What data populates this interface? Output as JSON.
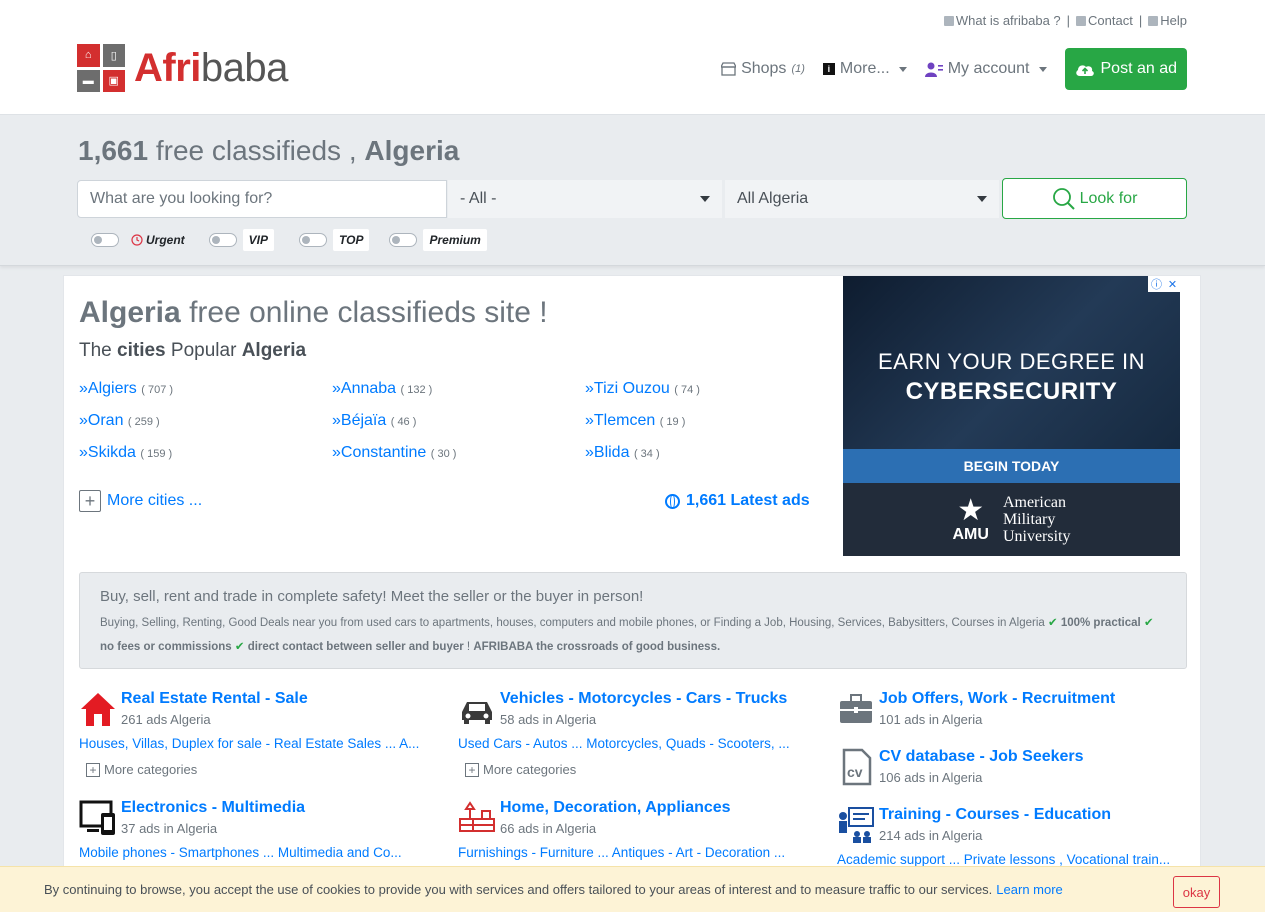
{
  "toplinks": {
    "about": "What is afribaba ?",
    "contact": "Contact",
    "help": "Help"
  },
  "logo": {
    "afri": "Afri",
    "baba": "baba"
  },
  "nav": {
    "shops": "Shops",
    "shops_count": "(1)",
    "more": "More...",
    "account": "My account",
    "post_ad": "Post an ad"
  },
  "search": {
    "count": "1,661",
    "title_rest": "free classifieds ,",
    "country": "Algeria",
    "placeholder": "What are you looking for?",
    "category_value": "- All -",
    "region_value": "All Algeria",
    "button": "Look for",
    "toggles": [
      "Urgent",
      "VIP",
      "TOP",
      "Premium"
    ]
  },
  "main": {
    "h1_bold": "Algeria",
    "h1_rest": "free online classifieds site !",
    "h2_a": "The",
    "h2_b": "cities",
    "h2_c": "Popular",
    "h2_d": "Algeria",
    "cities": [
      {
        "name": "»Algiers",
        "count": "( 707 )"
      },
      {
        "name": "»Annaba",
        "count": "( 132 )"
      },
      {
        "name": "»Tizi Ouzou",
        "count": "( 74 )"
      },
      {
        "name": "»Oran",
        "count": "( 259 )"
      },
      {
        "name": "»Béjaïa",
        "count": "( 46 )"
      },
      {
        "name": "»Tlemcen",
        "count": "( 19 )"
      },
      {
        "name": "»Skikda",
        "count": "( 159 )"
      },
      {
        "name": "»Constantine",
        "count": "( 30 )"
      },
      {
        "name": "»Blida",
        "count": "( 34 )"
      }
    ],
    "more_cities": "More cities ...",
    "latest_ads": "1,661 Latest ads"
  },
  "ad": {
    "line1": "EARN YOUR DEGREE IN",
    "line2": "CYBERSECURITY",
    "cta": "BEGIN TODAY",
    "brand_short": "AMU",
    "brand_l1": "American",
    "brand_l2": "Military",
    "brand_l3": "University"
  },
  "info": {
    "lead": "Buy, sell, rent and trade in complete safety! Meet the seller or the buyer in person!",
    "small": "Buying, Selling, Renting, Good Deals near you from used cars to apartments, houses, computers and mobile phones, or Finding a Job, Housing, Services, Babysitters, Courses in Algeria",
    "b1": "100% practical",
    "b2": "no fees or commissions",
    "b3": "direct contact between seller and buyer",
    "b4": "AFRIBABA the crossroads of good business."
  },
  "categories": [
    {
      "title": "Real Estate Rental - Sale",
      "count": "261 ads Algeria",
      "sub": "Houses, Villas, Duplex for sale - Real Estate Sales ... A...",
      "more": "More categories",
      "icon": "house-icon"
    },
    {
      "title": "Vehicles - Motorcycles - Cars - Trucks",
      "count": "58 ads in Algeria",
      "sub": "Used Cars - Autos ... Motorcycles, Quads - Scooters, ...",
      "more": "More categories",
      "icon": "car-icon"
    },
    {
      "title": "Job Offers, Work - Recruitment",
      "count": "101 ads in Algeria",
      "sub": "",
      "more": "",
      "icon": "briefcase-icon"
    },
    {
      "title": "CV database - Job Seekers",
      "count": "106 ads in Algeria",
      "sub": "",
      "more": "",
      "icon": "cv-icon"
    },
    {
      "title": "Electronics - Multimedia",
      "count": "37 ads in Algeria",
      "sub": "Mobile phones - Smartphones ... Multimedia and Co...",
      "more": "",
      "icon": "devices-icon"
    },
    {
      "title": "Home, Decoration, Appliances",
      "count": "66 ads in Algeria",
      "sub": "Furnishings - Furniture ... Antiques - Art - Decoration ...",
      "more": "",
      "icon": "furniture-icon"
    },
    {
      "title": "Training - Courses - Education",
      "count": "214 ads in Algeria",
      "sub": "Academic support ... Private lessons , Vocational train...",
      "more": "",
      "icon": "training-icon"
    }
  ],
  "cookie": {
    "text": "By continuing to browse, you accept the use of cookies to provide you with services and offers tailored to your areas of interest and to measure traffic to our services.",
    "learn": "Learn more",
    "ok": "okay"
  }
}
